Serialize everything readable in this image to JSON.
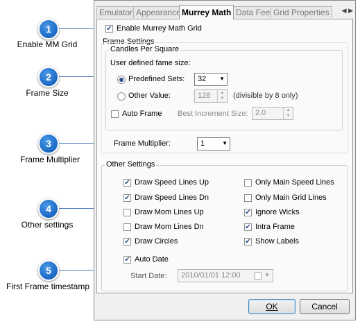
{
  "callouts": [
    {
      "number": "1",
      "label": "Enable MM Grid"
    },
    {
      "number": "2",
      "label": "Frame Size"
    },
    {
      "number": "3",
      "label": "Frame Multiplier"
    },
    {
      "number": "4",
      "label": "Other settings"
    },
    {
      "number": "5",
      "label": "First Frame timestamp"
    }
  ],
  "tabs": [
    "Emulator",
    "Appearance",
    "Murrey Math",
    "Data Feed",
    "Grid Properties"
  ],
  "active_tab": "Murrey Math",
  "enable_grid": {
    "label": "Enable Murrey Math Grid",
    "checked": true
  },
  "frame_settings": {
    "title": "Frame Settings",
    "candles_title": "Candles Per Square",
    "user_defined_label": "User defined fame size:",
    "predefined": {
      "label": "Predefined Sets:",
      "value": "32",
      "selected": true
    },
    "other": {
      "label": "Other Value:",
      "value": "128",
      "hint": "(divisible by 8 only)",
      "selected": false
    },
    "auto_frame": {
      "label": "Auto Frame",
      "checked": false
    },
    "best_increment": {
      "label": "Best Increment Size:",
      "value": "2.0"
    },
    "multiplier": {
      "label": "Frame Multiplier:",
      "value": "1"
    }
  },
  "other_settings": {
    "title": "Other Settings",
    "left": [
      {
        "label": "Draw Speed Lines Up",
        "checked": true
      },
      {
        "label": "Draw Speed Lines Dn",
        "checked": true
      },
      {
        "label": "Draw Mom Lines Up",
        "checked": false
      },
      {
        "label": "Draw Mom Lines Dn",
        "checked": false
      },
      {
        "label": "Draw Circles",
        "checked": true
      }
    ],
    "right": [
      {
        "label": "Only Main Speed Lines",
        "checked": false
      },
      {
        "label": "Only Main Grid Lines",
        "checked": false
      },
      {
        "label": "Ignore Wicks",
        "checked": true
      },
      {
        "label": "Intra Frame",
        "checked": true
      },
      {
        "label": "Show Labels",
        "checked": true
      }
    ],
    "auto_date": {
      "label": "Auto Date",
      "checked": true
    },
    "start_date": {
      "label": "Start Date:",
      "value": "2010/01/01 12:00"
    }
  },
  "buttons": {
    "ok": "OK",
    "cancel": "Cancel"
  }
}
